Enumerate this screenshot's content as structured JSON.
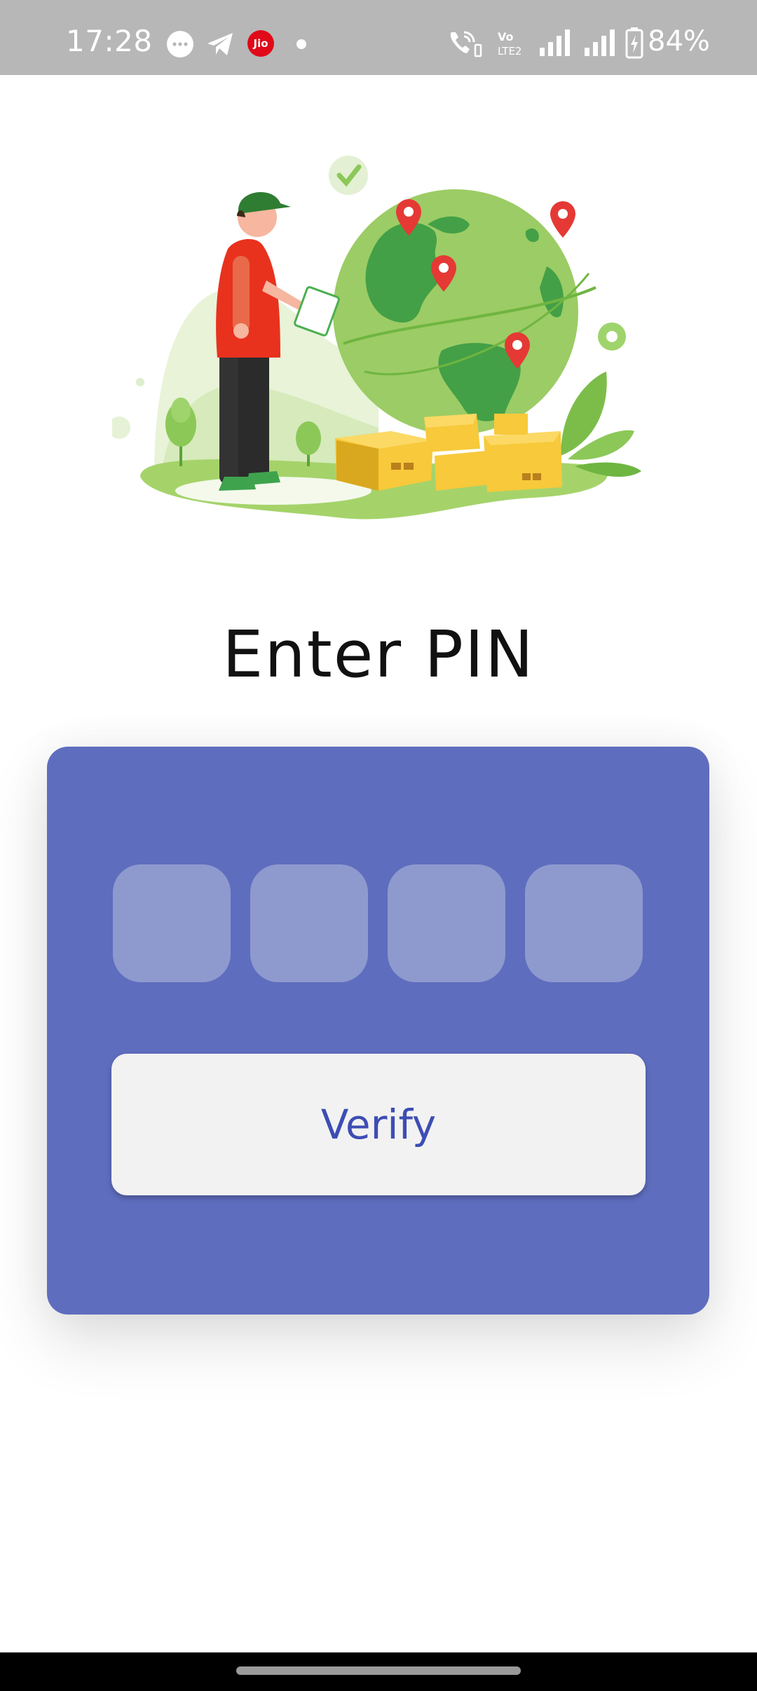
{
  "status_bar": {
    "time": "17:28",
    "carrier_badge": "Jio",
    "battery_percent": "84%",
    "icons": [
      "chat-bubble-icon",
      "telegram-icon",
      "jio-icon",
      "dot-icon",
      "wifi-call-icon",
      "volte-icon",
      "signal-icon",
      "signal-icon",
      "battery-icon"
    ]
  },
  "illustration": {
    "description_icon": "delivery-globe-illustration",
    "colors": {
      "globe": "#9ccc65",
      "land": "#43a047",
      "pin": "#e53935",
      "box": "#fbc02d",
      "shirt": "#e53935"
    }
  },
  "title": "Enter PIN",
  "pin": {
    "digit_count": 4,
    "values": [
      "",
      "",
      "",
      ""
    ]
  },
  "verify_button": {
    "label": "Verify"
  },
  "colors": {
    "card": "#5f6dbf",
    "pin_box": "#8e9ace",
    "button_bg": "#f2f2f2",
    "button_text": "#3d4db3"
  }
}
